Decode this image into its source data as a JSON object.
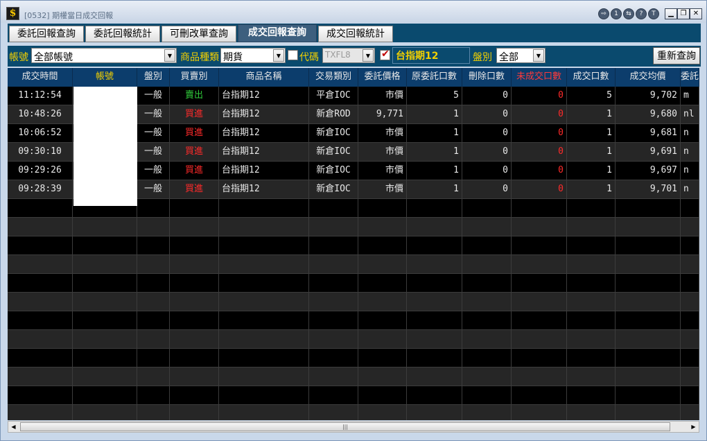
{
  "titlebar": {
    "app_icon": "$",
    "title": "[0532] 期權當日成交回報",
    "circle_buttons": [
      "⇨",
      "1",
      "⇆",
      "?",
      "T"
    ],
    "icon_names": [
      "export-icon",
      "one-icon",
      "switch-icon",
      "help-icon",
      "t-icon"
    ]
  },
  "tabs": [
    {
      "label": "委託回報查詢"
    },
    {
      "label": "委託回報統計"
    },
    {
      "label": "可刪改單查詢"
    },
    {
      "label": "成交回報查詢",
      "active": true
    },
    {
      "label": "成交回報統計"
    }
  ],
  "filters": {
    "account_label": "帳號",
    "account_value": "全部帳號",
    "product_type_label": "商品種類",
    "product_type_value": "期貨",
    "code_label": "代碼",
    "code_value": "TXFL8",
    "code_checked": false,
    "product_checked": true,
    "product_name": "台指期12",
    "session_label": "盤別",
    "session_value": "全部",
    "requery_label": "重新查詢"
  },
  "table": {
    "columns": [
      "成交時間",
      "帳號",
      "盤別",
      "買賣別",
      "商品名稱",
      "交易類別",
      "委託價格",
      "原委託口數",
      "刪除口數",
      "未成交口數",
      "成交口數",
      "成交均價",
      "委託"
    ],
    "rows": [
      [
        "11:12:54",
        "",
        "一般",
        "賣出",
        "台指期12",
        "平倉IOC",
        "市價",
        "5",
        "0",
        "0",
        "5",
        "9,702",
        "m"
      ],
      [
        "10:48:26",
        "",
        "一般",
        "買進",
        "台指期12",
        "新倉ROD",
        "9,771",
        "1",
        "0",
        "0",
        "1",
        "9,680",
        "nl"
      ],
      [
        "10:06:52",
        "",
        "一般",
        "買進",
        "台指期12",
        "新倉IOC",
        "市價",
        "1",
        "0",
        "0",
        "1",
        "9,681",
        "n"
      ],
      [
        "09:30:10",
        "",
        "一般",
        "買進",
        "台指期12",
        "新倉IOC",
        "市價",
        "1",
        "0",
        "0",
        "1",
        "9,691",
        "n"
      ],
      [
        "09:29:26",
        "",
        "一般",
        "買進",
        "台指期12",
        "新倉IOC",
        "市價",
        "1",
        "0",
        "0",
        "1",
        "9,697",
        "n"
      ],
      [
        "09:28:39",
        "",
        "一般",
        "買進",
        "台指期12",
        "新倉IOC",
        "市價",
        "1",
        "0",
        "0",
        "1",
        "9,701",
        "n"
      ]
    ]
  },
  "scrollbar": {
    "thumb_grip": "|||"
  },
  "colors": {
    "sell": "#2fc83a",
    "buy": "#ff2a2a",
    "unfilled": "#ff2a2a",
    "header_bg": "#0c3d6c",
    "toolbar_bg": "#0a4a6e",
    "label_yellow": "#f2d000"
  }
}
